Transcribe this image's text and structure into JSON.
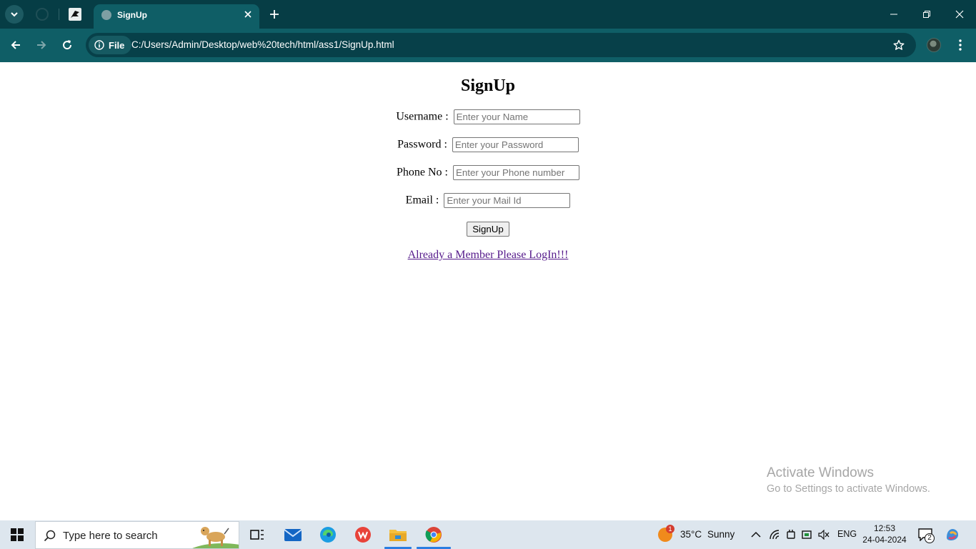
{
  "browser": {
    "tab_title": "SignUp",
    "site_info_label": "File",
    "url": "C:/Users/Admin/Desktop/web%20tech/html/ass1/SignUp.html"
  },
  "page": {
    "heading": "SignUp",
    "fields": [
      {
        "label": "Username :",
        "placeholder": "Enter your Name"
      },
      {
        "label": "Password :",
        "placeholder": "Enter your Password"
      },
      {
        "label": "Phone No :",
        "placeholder": "Enter your Phone number"
      },
      {
        "label": "Email :",
        "placeholder": "Enter your Mail Id"
      }
    ],
    "submit_label": "SignUp",
    "login_link": "Already a Member Please LogIn!!!"
  },
  "watermark": {
    "line1": "Activate Windows",
    "line2": "Go to Settings to activate Windows."
  },
  "taskbar": {
    "search_placeholder": "Type here to search",
    "weather_badge": "1",
    "weather_temp": "35°C",
    "weather_condition": "Sunny",
    "language": "ENG",
    "time": "12:53",
    "date": "24-04-2024",
    "notification_count": "2"
  },
  "colors": {
    "tabbar": "#063d45",
    "toolbar": "#0f5e66",
    "link_visited": "#551a8b",
    "taskbar": "#dde6ee"
  }
}
